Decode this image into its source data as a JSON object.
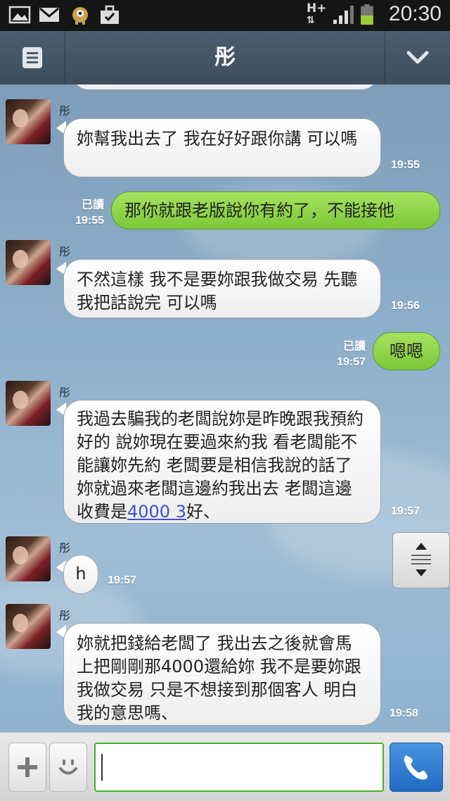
{
  "status_bar": {
    "time": "20:30",
    "network": "H+",
    "icons": [
      "gallery-icon",
      "gmail-icon",
      "app-icon",
      "briefcase-icon",
      "network-icon",
      "signal-icon",
      "battery-icon"
    ]
  },
  "header": {
    "title": "彤",
    "left_icon": "menu-icon",
    "right_icon": "chevron-down-icon"
  },
  "messages": [
    {
      "dir": "in",
      "sender": "彤",
      "text": "妳幫我出去了 我在好好跟你講 可以嗎",
      "time": "19:55"
    },
    {
      "dir": "out",
      "read": "已讀",
      "text": "那你就跟老版說你有約了，不能接他",
      "time": "19:55"
    },
    {
      "dir": "in",
      "sender": "彤",
      "text": "不然這樣  我不是要妳跟我做交易 先聽我把話說完 可以嗎",
      "time": "19:56"
    },
    {
      "dir": "out",
      "read": "已讀",
      "text": "嗯嗯",
      "time": "19:57"
    },
    {
      "dir": "in",
      "sender": "彤",
      "text_before": "我過去騙我的老闆說妳是昨晚跟我預約好的 說妳現在要過來約我  看老闆能不能讓妳先約  老闆要是相信我說的話了  妳就過來老闆這邊約我出去  老闆這邊收費是",
      "link": "4000  3",
      "text_after": "好、",
      "time": "19:57"
    },
    {
      "dir": "in",
      "sender": "彤",
      "text": "h",
      "time": "19:57"
    },
    {
      "dir": "in",
      "sender": "彤",
      "text": "妳就把錢給老闆了  我出去之後就會馬上把剛剛那4000還給妳  我不是要妳跟我做交易  只是不想接到那個客人  明白我的意思嗎、",
      "time": "19:58"
    }
  ],
  "input_bar": {
    "plus_icon": "plus-icon",
    "sticker_icon": "smiley-icon",
    "input_value": "",
    "call_icon": "phone-icon"
  },
  "colors": {
    "accent_green": "#7cc738",
    "header": "#465867",
    "call_blue": "#2a7bd1"
  }
}
